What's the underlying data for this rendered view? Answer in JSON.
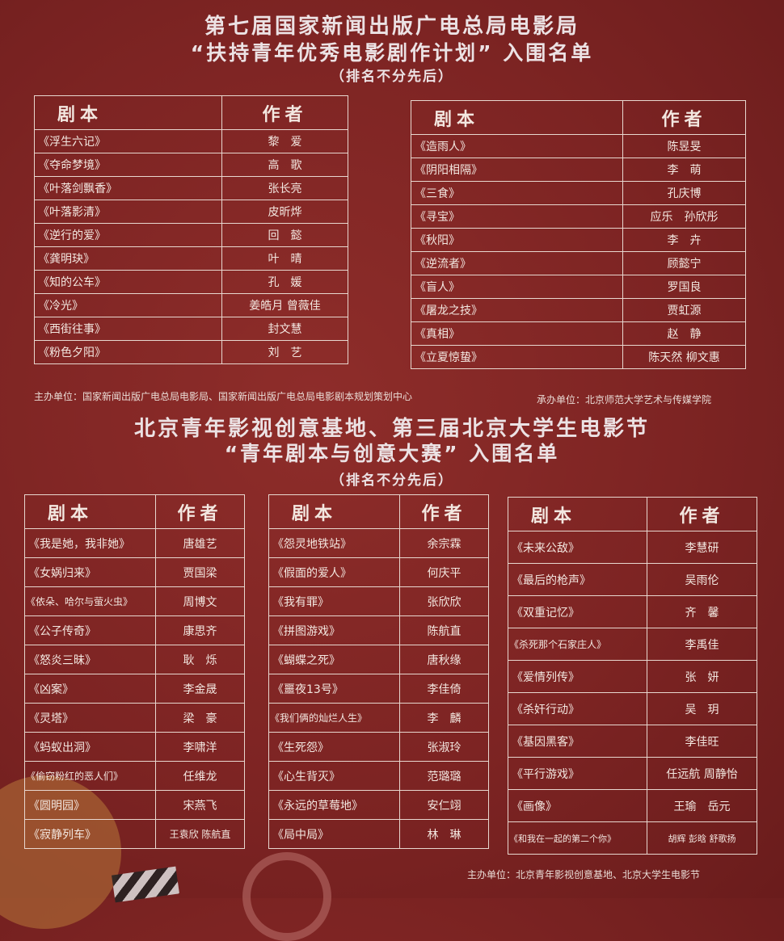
{
  "section1": {
    "title_line1": "第七届国家新闻出版广电总局电影局",
    "title_line2": "“扶持青年优秀电影剧作计划” 入围名单",
    "subtitle": "（排名不分先后）",
    "header_script": "剧本",
    "header_author": "作者",
    "table_left": [
      {
        "script": "《浮生六记》",
        "author": "黎　爱"
      },
      {
        "script": "《夺命梦境》",
        "author": "高　歌"
      },
      {
        "script": "《叶落剑飘香》",
        "author": "张长亮"
      },
      {
        "script": "《叶落影清》",
        "author": "皮昕烨"
      },
      {
        "script": "《逆行的爱》",
        "author": "回　懿"
      },
      {
        "script": "《龚明玦》",
        "author": "叶　晴"
      },
      {
        "script": "《知的公车》",
        "author": "孔　媛"
      },
      {
        "script": "《冷光》",
        "author": "姜皓月 曾薇佳"
      },
      {
        "script": "《西街往事》",
        "author": "封文慧"
      },
      {
        "script": "《粉色夕阳》",
        "author": "刘　艺"
      }
    ],
    "table_right": [
      {
        "script": "《造雨人》",
        "author": "陈昱旻"
      },
      {
        "script": "《阴阳相隔》",
        "author": "李　萌"
      },
      {
        "script": "《三食》",
        "author": "孔庆博"
      },
      {
        "script": "《寻宝》",
        "author": "应乐　孙欣彤"
      },
      {
        "script": "《秋阳》",
        "author": "李　卉"
      },
      {
        "script": "《逆流者》",
        "author": "顾懿宁"
      },
      {
        "script": "《盲人》",
        "author": "罗国良"
      },
      {
        "script": "《屠龙之技》",
        "author": "贾虹源"
      },
      {
        "script": "《真相》",
        "author": "赵　静"
      },
      {
        "script": "《立夏惊蛰》",
        "author": "陈天然 柳文惠"
      }
    ],
    "sponsor": "主办单位：国家新闻出版广电总局电影局、国家新闻出版广电总局电影剧本规划策划中心",
    "organizer": "承办单位：北京师范大学艺术与传媒学院"
  },
  "section2": {
    "title_line1": "北京青年影视创意基地、第三届北京大学生电影节",
    "title_line2": "“青年剧本与创意大赛” 入围名单",
    "subtitle": "（排名不分先后）",
    "header_script": "剧本",
    "header_author": "作者",
    "table_1": [
      {
        "script": "《我是她，我非她》",
        "author": "唐雄艺"
      },
      {
        "script": "《女娲归来》",
        "author": "贾国梁"
      },
      {
        "script": "《依朵、哈尔与萤火虫》",
        "author": "周博文"
      },
      {
        "script": "《公子传奇》",
        "author": "康思齐"
      },
      {
        "script": "《怒炎三昧》",
        "author": "耿　烁"
      },
      {
        "script": "《凶案》",
        "author": "李金晟"
      },
      {
        "script": "《灵塔》",
        "author": "梁　豪"
      },
      {
        "script": "《蚂蚁出洞》",
        "author": "李啸洋"
      },
      {
        "script": "《偷窃粉红的恶人们》",
        "author": "任维龙"
      },
      {
        "script": "《圆明园》",
        "author": "宋燕飞"
      },
      {
        "script": "《寂静列车》",
        "author": "王袁欣 陈航直"
      }
    ],
    "table_2": [
      {
        "script": "《怨灵地铁站》",
        "author": "余宗霖"
      },
      {
        "script": "《假面的爱人》",
        "author": "何庆平"
      },
      {
        "script": "《我有罪》",
        "author": "张欣欣"
      },
      {
        "script": "《拼图游戏》",
        "author": "陈航直"
      },
      {
        "script": "《蝴蝶之死》",
        "author": "唐秋缘"
      },
      {
        "script": "《噩夜13号》",
        "author": "李佳倚"
      },
      {
        "script": "《我们俩的灿烂人生》",
        "author": "李　麟"
      },
      {
        "script": "《生死怨》",
        "author": "张淑玲"
      },
      {
        "script": "《心生背灭》",
        "author": "范璐璐"
      },
      {
        "script": "《永远的草莓地》",
        "author": "安仁翊"
      },
      {
        "script": "《局中局》",
        "author": "林　琳"
      }
    ],
    "table_3": [
      {
        "script": "《未来公敌》",
        "author": "李慧研"
      },
      {
        "script": "《最后的枪声》",
        "author": "吴雨伦"
      },
      {
        "script": "《双重记忆》",
        "author": "齐　馨"
      },
      {
        "script": "《杀死那个石家庄人》",
        "author": "李禹佳"
      },
      {
        "script": "《爱情列传》",
        "author": "张　妍"
      },
      {
        "script": "《杀奸行动》",
        "author": "吴　玥"
      },
      {
        "script": "《基因黑客》",
        "author": "李佳旺"
      },
      {
        "script": "《平行游戏》",
        "author": "任远航 周静怡"
      },
      {
        "script": "《画像》",
        "author": "王瑜　岳元"
      },
      {
        "script": "《和我在一起的第二个你》",
        "author": "胡辉 彭晗 舒歌扬"
      }
    ],
    "sponsor": "主办单位：北京青年影视创意基地、北京大学生电影节"
  }
}
